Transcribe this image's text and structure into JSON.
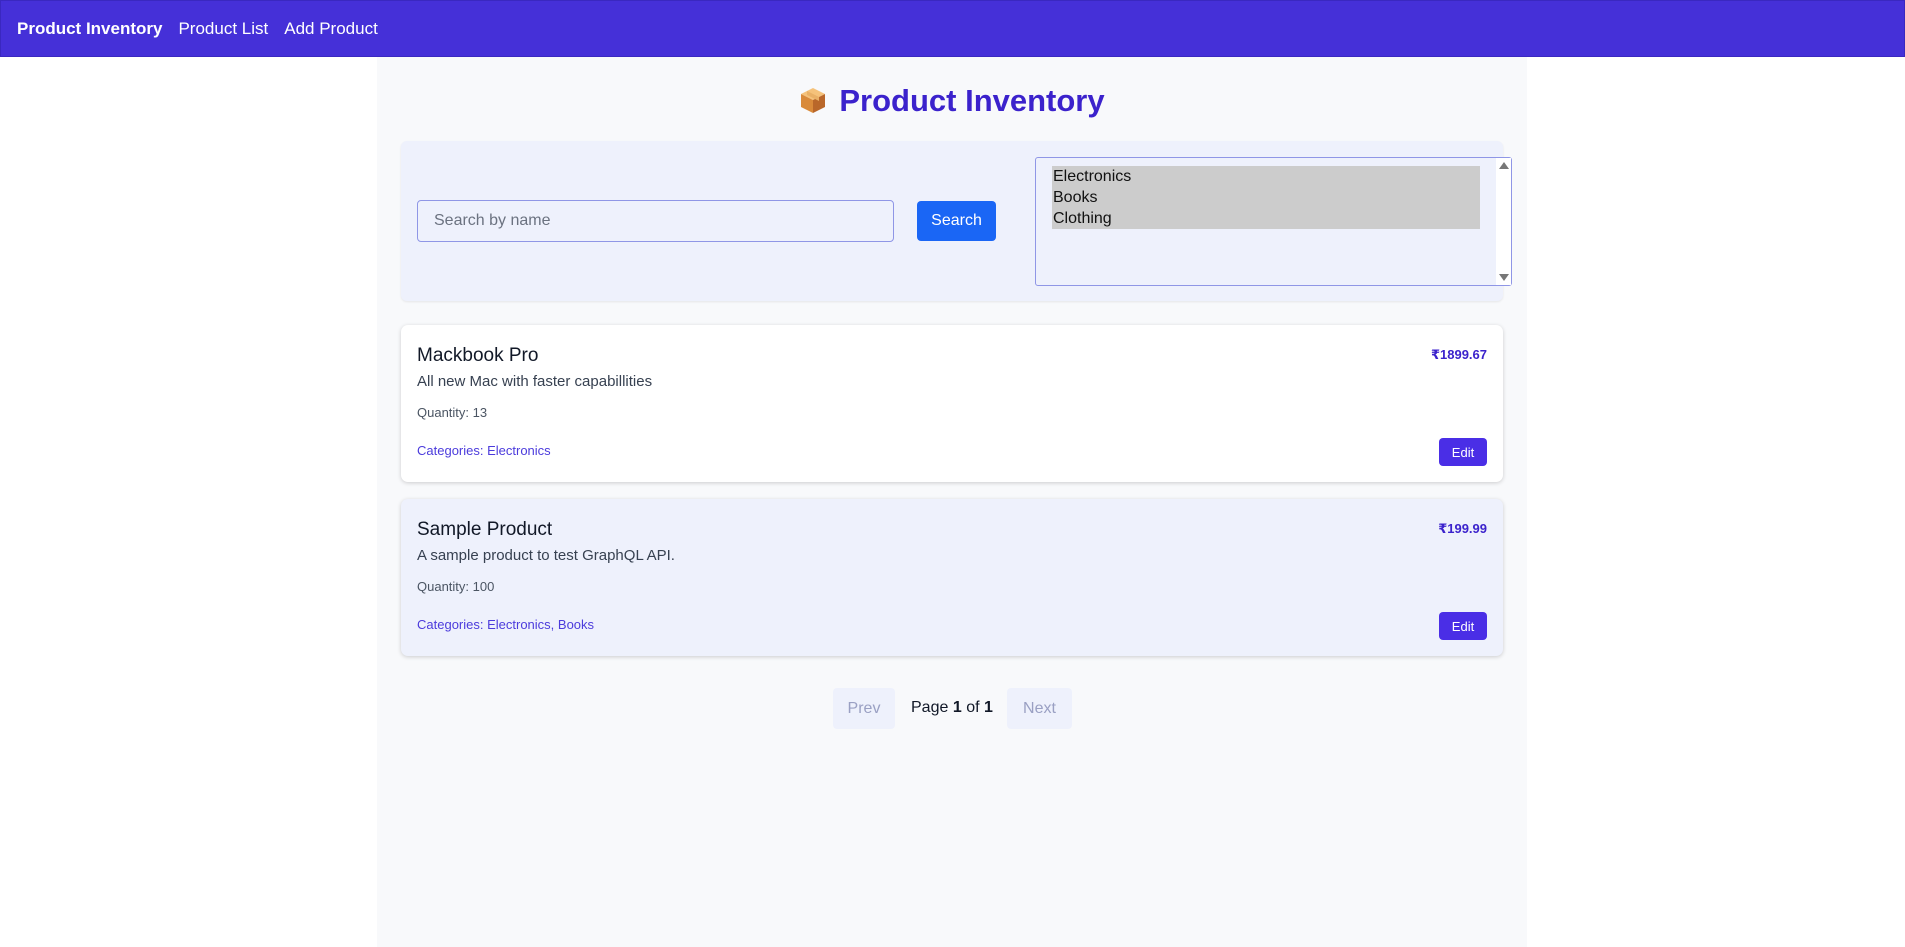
{
  "navbar": {
    "brand": "Product Inventory",
    "links": [
      "Product List",
      "Add Product"
    ]
  },
  "page": {
    "title": "Product Inventory",
    "title_icon": "package-icon",
    "accent_color": "#4530d8"
  },
  "filters": {
    "search_placeholder": "Search by name",
    "search_value": "",
    "search_button": "Search",
    "category_options": [
      "Electronics",
      "Books",
      "Clothing"
    ]
  },
  "products": [
    {
      "name": "Mackbook Pro",
      "description": "All new Mac with faster capabillities",
      "quantity": "Quantity: 13",
      "categories": "Categories: Electronics",
      "price": "₹1899.67",
      "edit_label": "Edit"
    },
    {
      "name": "Sample Product",
      "description": "A sample product to test GraphQL API.",
      "quantity": "Quantity: 100",
      "categories": "Categories: Electronics, Books",
      "price": "₹199.99",
      "edit_label": "Edit"
    }
  ],
  "pagination": {
    "prev_label": "Prev",
    "next_label": "Next",
    "page_word": "Page",
    "of_word": "of",
    "current_page": "1",
    "total_pages": "1"
  }
}
